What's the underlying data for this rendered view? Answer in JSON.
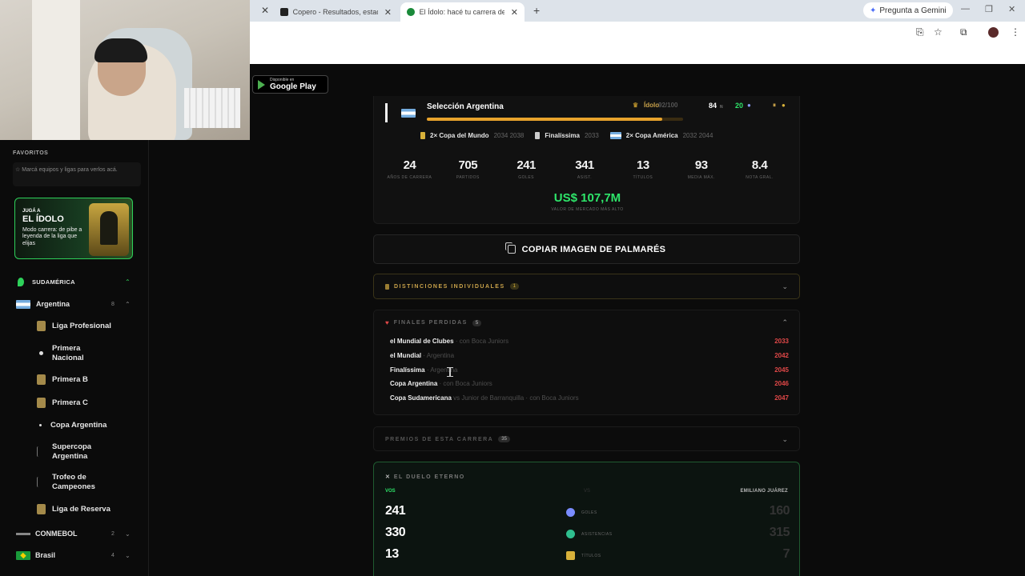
{
  "browser": {
    "tabs": [
      {
        "title": "Copero - Resultados, estadísticas",
        "favicon_color": "#222222"
      },
      {
        "title": "El Ídolo: hacé tu carrera de fútbol",
        "favicon_color": "#1a8a3a"
      }
    ],
    "gemini_label": "Pregunta a Gemini",
    "profile_initial": "I"
  },
  "store_badge": {
    "small": "Disponible en",
    "big": "Google Play"
  },
  "sidebar": {
    "favorites_title": "FAVORITOS",
    "favorites_hint": "Marcá equipos y ligas para verlos acá.",
    "promo": {
      "line1": "JUGÁ A",
      "line2": "EL ÍDOLO",
      "line3": "Modo carrera: de pibe a leyenda de la liga que elijas"
    },
    "region": {
      "label": "SUDAMÉRICA"
    },
    "country": {
      "label": "Argentina",
      "count": "8"
    },
    "leagues": [
      {
        "label": "Liga Profesional",
        "icon": "league-shield-icon"
      },
      {
        "label": "Primera Nacional",
        "icon": "dot-icon"
      },
      {
        "label": "Primera B",
        "icon": "league-shield-icon"
      },
      {
        "label": "Primera C",
        "icon": "league-shield-icon"
      },
      {
        "label": "Copa Argentina",
        "icon": "dot-icon"
      },
      {
        "label": "Supercopa Argentina",
        "icon": "trophy-icon"
      },
      {
        "label": "Trofeo de Campeones",
        "icon": "trophy-icon"
      },
      {
        "label": "Liga de Reserva",
        "icon": "league-shield-icon"
      }
    ],
    "conmebol": {
      "label": "CONMEBOL",
      "count": "2"
    },
    "brasil": {
      "label": "Brasil",
      "count": "4"
    }
  },
  "career": {
    "team": "Selección Argentina",
    "idolo_label": "Ídolo",
    "idolo_score": "92/100",
    "rating": "84",
    "rating_suffix": "N",
    "green_num": "20",
    "progress_pct": 92,
    "honors": [
      {
        "label": "2× Copa del Mundo",
        "years": "2034 2038"
      },
      {
        "label": "Finalíssima",
        "years": "2033"
      },
      {
        "label": "2× Copa América",
        "years": "2032 2044"
      }
    ],
    "stats": [
      {
        "value": "24",
        "label": "AÑOS DE CARRERA"
      },
      {
        "value": "705",
        "label": "PARTIDOS"
      },
      {
        "value": "241",
        "label": "GOLES"
      },
      {
        "value": "341",
        "label": "ASIST."
      },
      {
        "value": "13",
        "label": "TÍTULOS"
      },
      {
        "value": "93",
        "label": "MEDIA MÁX."
      },
      {
        "value": "8.4",
        "label": "NOTA GRAL."
      }
    ],
    "market_value": "US$ 107,7M",
    "market_label": "VALOR DE MERCADO MÁS ALTO"
  },
  "copy_button": "COPIAR IMAGEN DE PALMARÉS",
  "distinciones": {
    "title": "DISTINCIONES INDIVIDUALES",
    "count": "1"
  },
  "finales": {
    "title": "FINALES PERDIDAS",
    "count": "5",
    "rows": [
      {
        "comp": "el Mundial de Clubes",
        "sub": "· con Boca Juniors",
        "year": "2033"
      },
      {
        "comp": "el Mundial",
        "sub": "· Argentina",
        "year": "2042"
      },
      {
        "comp": "Finalíssima",
        "sub": "· Argentina",
        "year": "2045"
      },
      {
        "comp": "Copa Argentina",
        "sub": "· con Boca Juniors",
        "year": "2046"
      },
      {
        "comp": "Copa Sudamericana",
        "sub": "vs Junior de Barranquilla · con Boca Juniors",
        "year": "2047"
      }
    ]
  },
  "premios": {
    "title": "PREMIOS DE ESTA CARRERA",
    "count": "35"
  },
  "duel": {
    "title": "EL DUELO ETERNO",
    "you": "VOS",
    "vs": "VS",
    "rival": "EMILIANO JUÁREZ",
    "rows": [
      {
        "mine": "241",
        "label": "GOLES",
        "theirs": "160",
        "color": "#7a8cff"
      },
      {
        "mine": "330",
        "label": "ASISTENCIAS",
        "theirs": "315",
        "color": "#2fbf8f"
      },
      {
        "mine": "13",
        "label": "TÍTULOS",
        "theirs": "7",
        "color": "#d8b13a"
      }
    ]
  }
}
